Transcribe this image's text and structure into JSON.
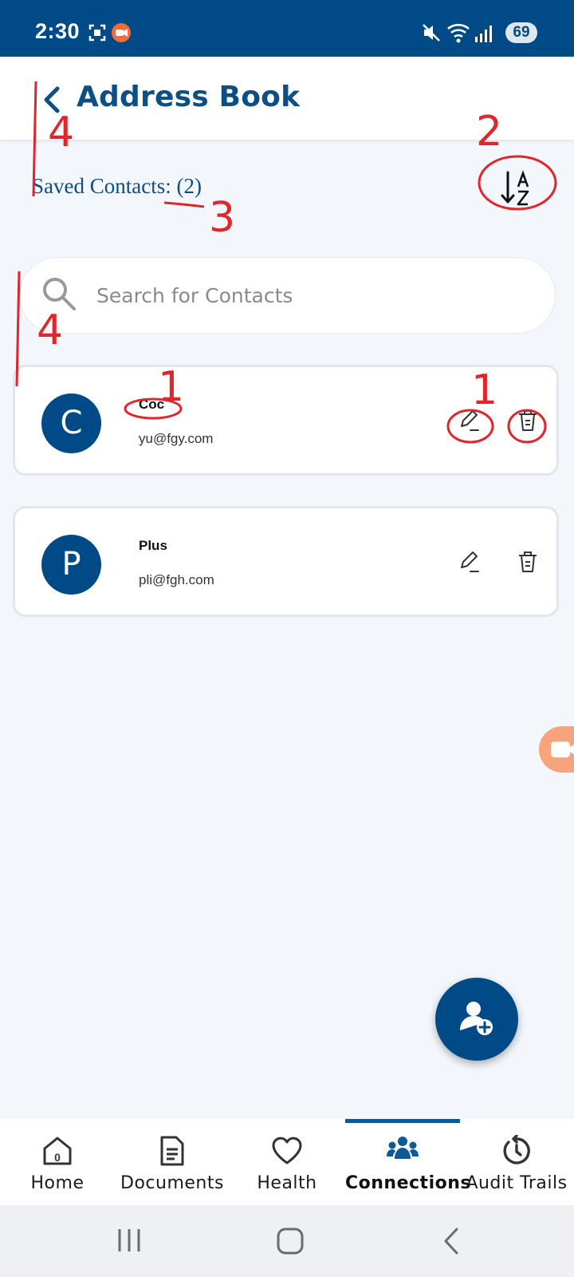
{
  "status_bar": {
    "time": "2:30",
    "battery": "69"
  },
  "header": {
    "title": "Address Book"
  },
  "saved_contacts_label": "Saved Contacts: (2)",
  "search": {
    "placeholder": "Search for Contacts",
    "value": ""
  },
  "contacts": [
    {
      "initial": "C",
      "name": "Coc",
      "email": "yu@fgy.com"
    },
    {
      "initial": "P",
      "name": "Plus",
      "email": "pli@fgh.com"
    }
  ],
  "annotations": [
    "4",
    "2",
    "3",
    "4",
    "1",
    "1"
  ],
  "bottom_nav": {
    "items": [
      {
        "label": "Home",
        "icon": "home-icon",
        "badge": "0"
      },
      {
        "label": "Documents",
        "icon": "document-icon"
      },
      {
        "label": "Health",
        "icon": "heart-icon"
      },
      {
        "label": "Connections",
        "icon": "people-icon",
        "active": true
      },
      {
        "label": "Audit Trails",
        "icon": "history-icon"
      }
    ]
  },
  "colors": {
    "brand": "#004b87",
    "background": "#f3f7fc",
    "annotation": "#e0262b"
  }
}
